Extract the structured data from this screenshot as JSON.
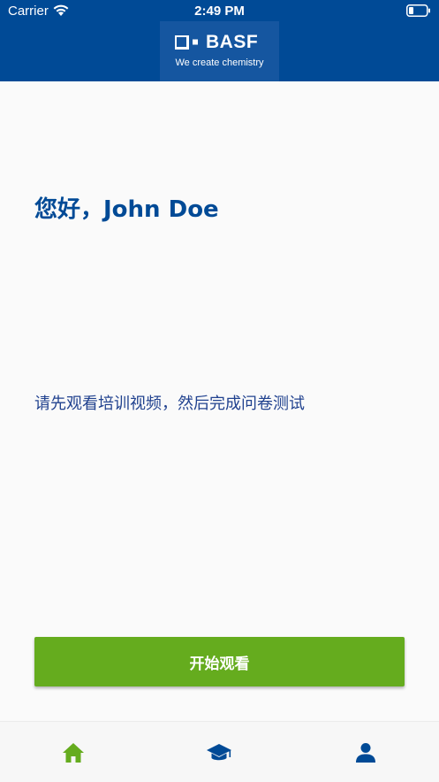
{
  "status_bar": {
    "carrier": "Carrier",
    "time": "2:49 PM"
  },
  "header": {
    "logo_text": "BASF",
    "tagline": "We create chemistry"
  },
  "main": {
    "greeting": "您好，John Doe",
    "instruction": "请先观看培训视频，然后完成问卷测试",
    "start_button_label": "开始观看"
  },
  "tab_bar": {
    "items": [
      {
        "icon": "home-icon",
        "active": true
      },
      {
        "icon": "graduation-cap-icon",
        "active": false
      },
      {
        "icon": "user-icon",
        "active": false
      }
    ]
  },
  "colors": {
    "brand_blue": "#004a96",
    "accent_green": "#65ac1e"
  }
}
